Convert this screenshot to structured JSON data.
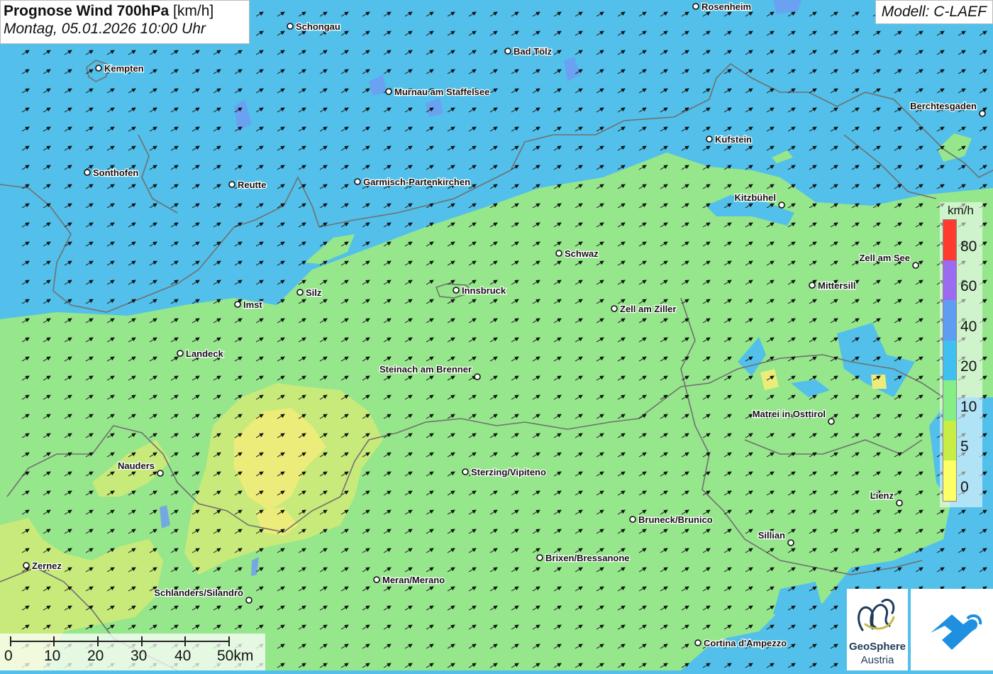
{
  "title": {
    "main": "Prognose Wind 700hPa",
    "unit": "[km/h]",
    "datetime": "Montag, 05.01.2026 10:00 Uhr"
  },
  "model": "Modell: C-LAEF",
  "legend": {
    "unit": "km/h",
    "ticks": [
      "80",
      "60",
      "40",
      "20",
      "10",
      "5",
      "0"
    ],
    "colors": [
      "#ff3b30",
      "#9b6cf0",
      "#5f9cf2",
      "#40c0f0",
      "#86ee86",
      "#c8ee46",
      "#ffff66"
    ]
  },
  "colors": {
    "wind_20_40": "#52c0ea",
    "wind_10_20": "#96e68c",
    "wind_5_10": "#c8ea7a",
    "wind_0_5": "#ecec7a",
    "border": "#707070",
    "arrow": "#111111"
  },
  "wind_direction": "from south-west (arrows pointing north-east)",
  "cities": [
    {
      "name": "Rosenheim"
    },
    {
      "name": "Schongau"
    },
    {
      "name": "Bad Tölz"
    },
    {
      "name": "Kempten"
    },
    {
      "name": "Murnau am Staffelsee"
    },
    {
      "name": "Berchtesgaden"
    },
    {
      "name": "Kufstein"
    },
    {
      "name": "Sonthofen"
    },
    {
      "name": "Reutte"
    },
    {
      "name": "Garmisch-Partenkirchen"
    },
    {
      "name": "Kitzbühel"
    },
    {
      "name": "Schwaz"
    },
    {
      "name": "Zell am See"
    },
    {
      "name": "Innsbruck"
    },
    {
      "name": "Mittersill"
    },
    {
      "name": "Silz"
    },
    {
      "name": "Imst"
    },
    {
      "name": "Zell am Ziller"
    },
    {
      "name": "Landeck"
    },
    {
      "name": "Steinach am Brenner"
    },
    {
      "name": "Matrei in Osttirol"
    },
    {
      "name": "Nauders"
    },
    {
      "name": "Sterzing/Vipiteno"
    },
    {
      "name": "Lienz"
    },
    {
      "name": "Bruneck/Brunico"
    },
    {
      "name": "Sillian"
    },
    {
      "name": "Brixen/Bressanone"
    },
    {
      "name": "Zernez"
    },
    {
      "name": "Meran/Merano"
    },
    {
      "name": "Schlanders/Silandro"
    },
    {
      "name": "Cortina d'Ampezzo"
    }
  ],
  "scale": {
    "labels": [
      "0",
      "10",
      "20",
      "30",
      "40",
      "50km"
    ]
  },
  "logos": {
    "geosphere_name": "GeoSphere",
    "geosphere_sub": "Austria"
  }
}
